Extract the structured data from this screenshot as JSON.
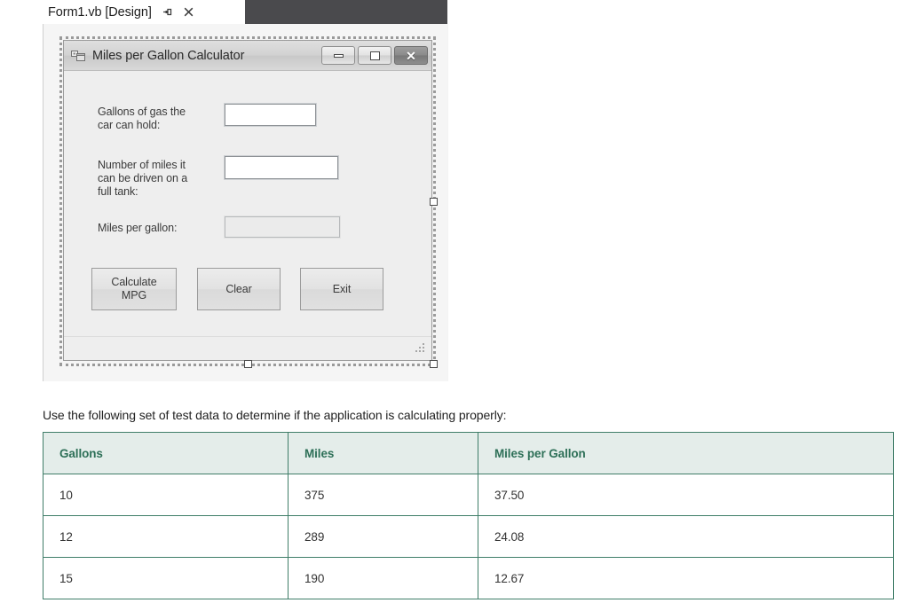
{
  "ide": {
    "tab": {
      "title": "Form1.vb [Design]",
      "pin_icon": "pin-icon",
      "close_icon": "close-icon"
    }
  },
  "form": {
    "icon": "vb-form-icon",
    "title": "Miles per Gallon Calculator",
    "window_controls": {
      "minimize_label": "–",
      "maximize_label": "□",
      "close_label": "✕"
    },
    "fields": [
      {
        "label": "Gallons of gas the\ncar can hold:",
        "value": "",
        "readonly": false
      },
      {
        "label": "Number of miles it\ncan be driven on a\nfull tank:",
        "value": "",
        "readonly": false
      },
      {
        "label": "Miles per gallon:",
        "value": "",
        "readonly": true
      }
    ],
    "buttons": [
      {
        "label": "Calculate\nMPG"
      },
      {
        "label": "Clear"
      },
      {
        "label": "Exit"
      }
    ]
  },
  "document": {
    "intro": "Use the following set of test data to determine if the application is calculating properly:",
    "table": {
      "headers": [
        "Gallons",
        "Miles",
        "Miles per Gallon"
      ],
      "rows": [
        [
          "10",
          "375",
          "37.50"
        ],
        [
          "12",
          "289",
          "24.08"
        ],
        [
          "15",
          "190",
          "12.67"
        ]
      ]
    }
  },
  "colors": {
    "table_border": "#3f7d68",
    "table_header_bg": "#e4edea",
    "table_header_text": "#2e7058",
    "tabstrip_bg": "#4a4a4d",
    "form_bg": "#eeeeee"
  }
}
